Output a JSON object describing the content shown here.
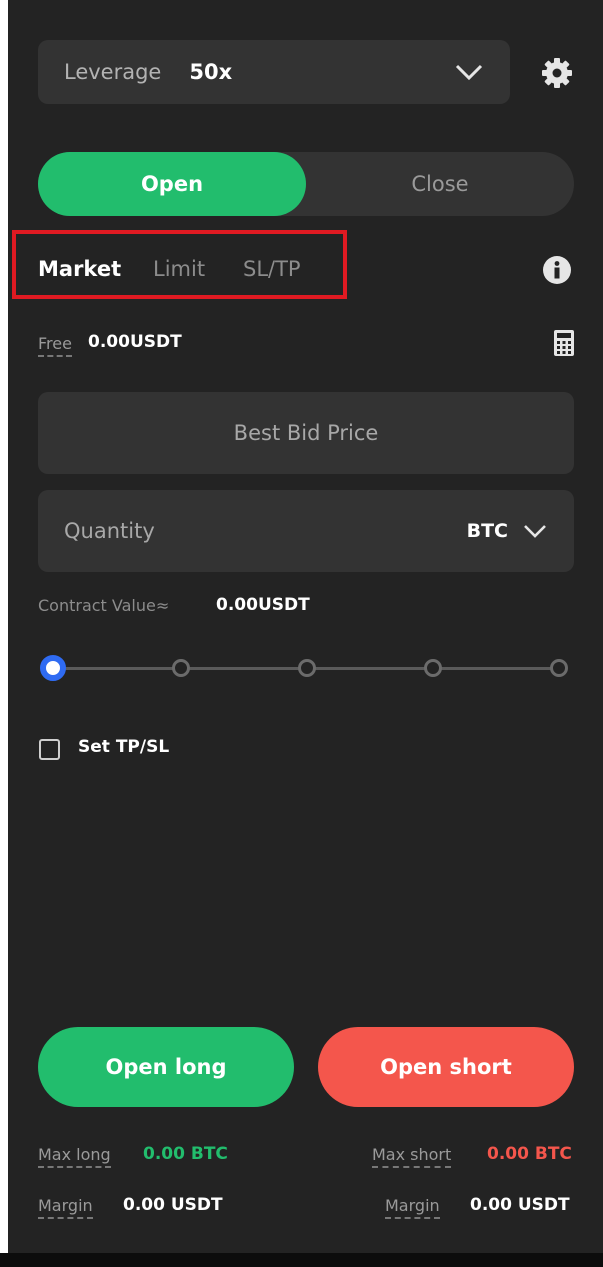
{
  "leverage": {
    "label": "Leverage",
    "value": "50x"
  },
  "mode_toggle": {
    "open": "Open",
    "close": "Close"
  },
  "order_types": [
    "Market",
    "Limit",
    "SL/TP"
  ],
  "free": {
    "label": "Free",
    "value": "0.00USDT"
  },
  "price_field": {
    "placeholder": "Best Bid Price"
  },
  "quantity_field": {
    "placeholder": "Quantity",
    "unit": "BTC"
  },
  "contract_value": {
    "label": "Contract Value≈",
    "value": "0.00USDT"
  },
  "slider": {
    "value_fraction": 0,
    "stops": 5
  },
  "tpsl": {
    "label": "Set TP/SL",
    "checked": false
  },
  "actions": {
    "long": "Open long",
    "short": "Open short"
  },
  "footer": {
    "max_long": {
      "label": "Max long",
      "value": "0.00 BTC"
    },
    "max_short": {
      "label": "Max short",
      "value": "0.00 BTC"
    },
    "margin_long": {
      "label": "Margin",
      "value": "0.00 USDT"
    },
    "margin_short": {
      "label": "Margin",
      "value": "0.00 USDT"
    }
  },
  "colors": {
    "accent_green": "#22bd6d",
    "accent_red": "#f4564c",
    "slider_blue": "#2f6bf2",
    "highlight_red": "#e01a22"
  },
  "icons": [
    "chevron-down-icon",
    "gear-icon",
    "info-icon",
    "calculator-icon"
  ]
}
